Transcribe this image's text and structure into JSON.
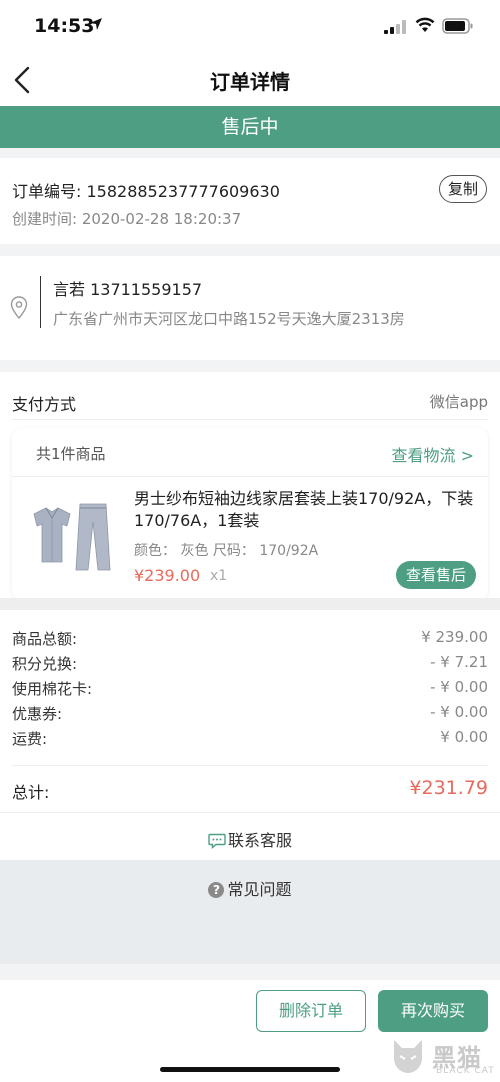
{
  "status_bar": {
    "time": "14:53"
  },
  "nav": {
    "title": "订单详情"
  },
  "order_status": "售后中",
  "order": {
    "number": "订单编号: 1582885237777609630",
    "created": "创建时间: 2020-02-28 18:20:37",
    "copy_label": "复制"
  },
  "address": {
    "name_phone": "言若 13711559157",
    "detail": "广东省广州市天河区龙口中路152号天逸大厦2313房"
  },
  "payment": {
    "label": "支付方式",
    "value": "微信app"
  },
  "goods": {
    "count_label": "共1件商品",
    "logistics_label": "查看物流 >",
    "name": "男士纱布短袖边线家居套装上装170/92A，下装170/76A，1套装",
    "spec": "颜色： 灰色  尺码： 170/92A",
    "price": "¥239.00",
    "qty": "x1",
    "aftersale_label": "查看售后"
  },
  "summary": {
    "rows": [
      {
        "label": "商品总额:",
        "value": "¥ 239.00"
      },
      {
        "label": "积分兑换:",
        "value": "- ¥ 7.21"
      },
      {
        "label": "使用棉花卡:",
        "value": "- ¥ 0.00"
      },
      {
        "label": "优惠券:",
        "value": "- ¥ 0.00"
      },
      {
        "label": "运费:",
        "value": "¥ 0.00"
      }
    ],
    "total_label": "总计:",
    "total_value": "¥231.79"
  },
  "support": {
    "contact_label": "联系客服",
    "faq_label": "常见问题"
  },
  "actions": {
    "delete_label": "删除订单",
    "rebuy_label": "再次购买"
  },
  "watermark": {
    "text": "黑猫",
    "sub": "BLACK CAT"
  },
  "colors": {
    "accent": "#4e9e84",
    "price": "#e86a5c"
  }
}
